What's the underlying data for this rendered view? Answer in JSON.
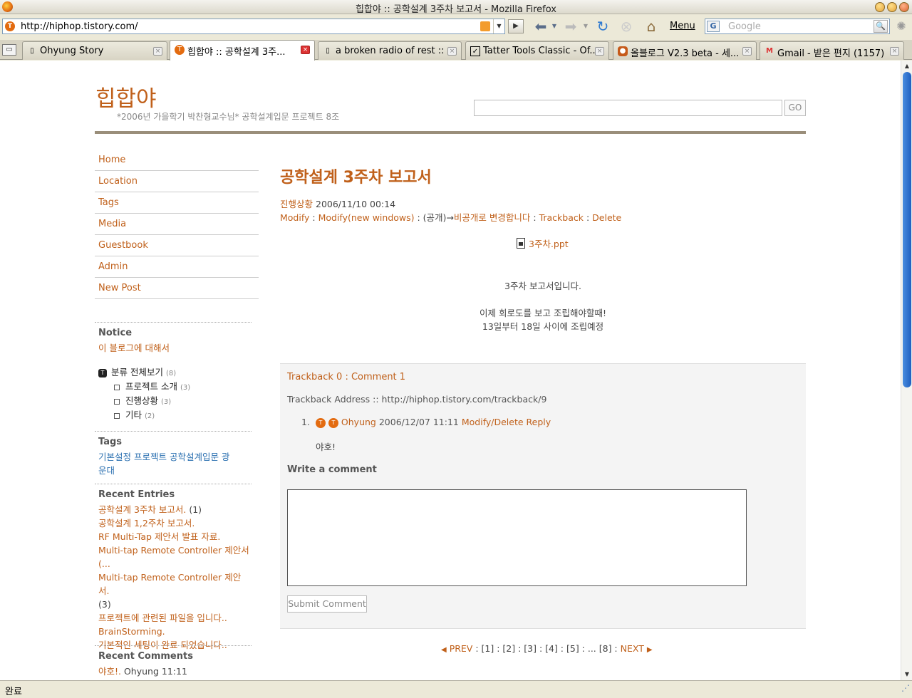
{
  "window": {
    "title": "힙합야 :: 공학설계 3주차 보고서 - Mozilla Firefox"
  },
  "navbar": {
    "url": "http://hiphop.tistory.com/",
    "menu_label": "Menu",
    "search_placeholder": "Google"
  },
  "tabs": [
    {
      "label": "Ohyung Story",
      "active": false
    },
    {
      "label": "힙합야 :: 공학설계 3주...",
      "active": true
    },
    {
      "label": "a broken radio of rest ::",
      "active": false
    },
    {
      "label": "Tatter Tools Classic - Of...",
      "active": false
    },
    {
      "label": "올블로그 V2.3 beta - 세...",
      "active": false
    },
    {
      "label": "Gmail - 받은 편지 (1157)",
      "active": false
    }
  ],
  "status": {
    "text": "완료"
  },
  "blog": {
    "title": "힙합야",
    "description": "*2006년 가을학기 박찬형교수님* 공학설계입문 프로젝트 8조",
    "search_button": "GO"
  },
  "sidebar": {
    "nav": [
      "Home",
      "Location",
      "Tags",
      "Media",
      "Guestbook",
      "Admin",
      "New Post"
    ],
    "notice": {
      "heading": "Notice",
      "items": [
        "이 블로그에 대해서"
      ]
    },
    "categories": {
      "root": {
        "label": "분류 전체보기",
        "count": "(8)"
      },
      "children": [
        {
          "label": "프로젝트 소개",
          "count": "(3)"
        },
        {
          "label": "진행상황",
          "count": "(3)"
        },
        {
          "label": "기타",
          "count": "(2)"
        }
      ]
    },
    "tags": {
      "heading": "Tags",
      "line1": "기본설정 프로젝트 공학설계입문 광",
      "line2": "운대"
    },
    "recent_entries": {
      "heading": "Recent Entries",
      "items": [
        {
          "text": "공학설계 3주차 보고서.",
          "extra": " (1)"
        },
        {
          "text": "공학설계 1,2주차 보고서.",
          "extra": ""
        },
        {
          "text": "RF Multi-Tap 제안서 발표 자료.",
          "extra": ""
        },
        {
          "text": "Multi-tap Remote Controller 제안서",
          "extra": ""
        },
        {
          "text": "(...",
          "extra": ""
        },
        {
          "text": "Multi-tap Remote Controller 제안서.",
          "extra": ""
        },
        {
          "text": "",
          "extra": "(3)"
        },
        {
          "text": "프로젝트에 관련된 파일을 입니다..",
          "extra": ""
        },
        {
          "text": "BrainStorming.",
          "extra": ""
        },
        {
          "text": "기본적인 세팅이 완료 되었습니다..",
          "extra": ""
        }
      ]
    },
    "recent_comments": {
      "heading": "Recent Comments",
      "items": [
        {
          "text": "야호!.",
          "author": " Ohyung 11:11"
        }
      ]
    }
  },
  "post": {
    "title": "공학설계 3주차 보고서",
    "category": "진행상황",
    "date": " 2006/11/10 00:14",
    "actions": {
      "modify": "Modify",
      "sep1": " : ",
      "modify_new": "Modify(new windows)",
      "sep2": " : (공개)→",
      "to_private": "비공개로 변경합니다",
      "sep3": " : ",
      "trackback": "Trackback",
      "sep4": " : ",
      "delete": "Delete"
    },
    "attachment": "3주차.ppt",
    "body": [
      "3주차 보고서입니다.",
      "",
      "이제 회로도를 보고 조립해야할때!",
      "13일부터 18일 사이에 조립예정"
    ]
  },
  "comments": {
    "header": "Trackback 0 : Comment 1",
    "trackback_address": "Trackback Address :: http://hiphop.tistory.com/trackback/9",
    "items": [
      {
        "number": "1.",
        "author": "Ohyung",
        "date": " 2006/12/07 11:11 ",
        "modify_delete": "Modify/Delete",
        "reply": "Reply",
        "text": "야호!"
      }
    ],
    "write_heading": "Write a comment",
    "submit_label": "Submit Comment"
  },
  "pager": {
    "prev": "PREV",
    "pages": " : [1] : [2] : [3] : [4] : [5] : ... [8] : ",
    "next": "NEXT"
  },
  "colors": {
    "accent": "#c0601a",
    "rule": "#9a8e7a",
    "scroll_thumb": "#1f5fbf"
  }
}
